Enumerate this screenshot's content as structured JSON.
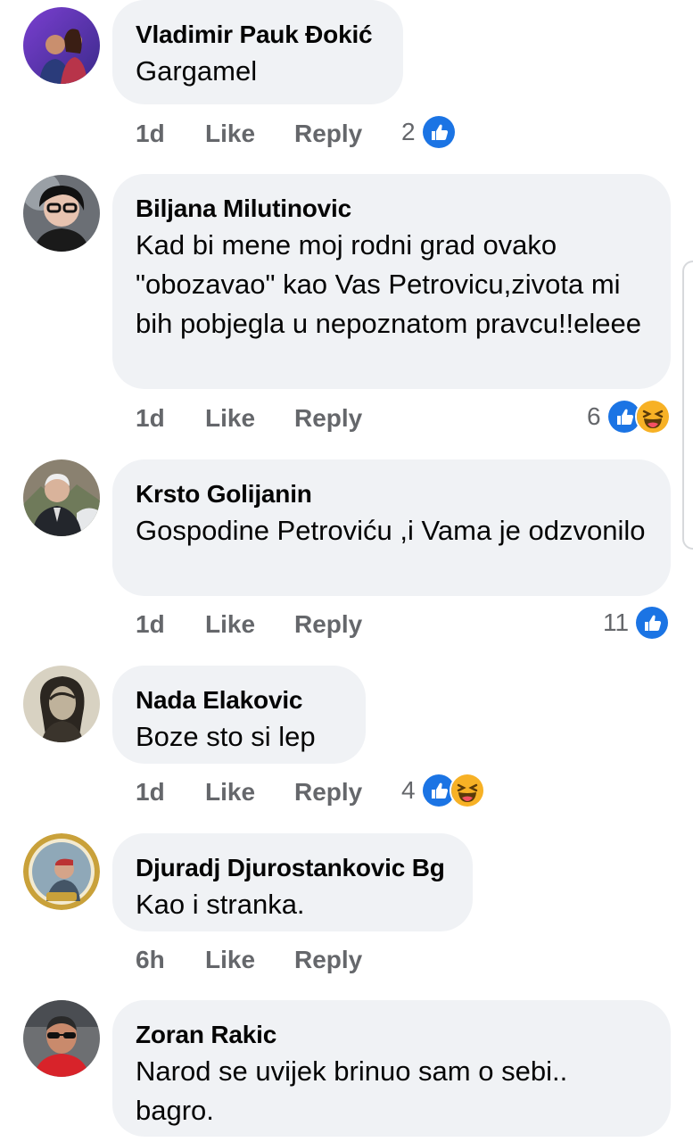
{
  "comments": [
    {
      "author": "Vladimir Pauk Đokić",
      "text": "Gargamel",
      "time": "1d",
      "like_label": "Like",
      "reply_label": "Reply",
      "reaction_count": "2",
      "reactions": [
        "like-icon"
      ]
    },
    {
      "author": "Biljana Milutinovic",
      "text": "Kad bi mene moj rodni grad ovako \"obozavao\" kao Vas Petrovicu,zivota mi bih pobjegla u nepoznatom pravcu!!eleee",
      "time": "1d",
      "like_label": "Like",
      "reply_label": "Reply",
      "reaction_count": "6",
      "reactions": [
        "like-icon",
        "haha-icon"
      ]
    },
    {
      "author": "Krsto Golijanin",
      "text": "Gospodine Petroviću ,i Vama je odzvonilo",
      "time": "1d",
      "like_label": "Like",
      "reply_label": "Reply",
      "reaction_count": "11",
      "reactions": [
        "like-icon"
      ]
    },
    {
      "author": "Nada Elakovic",
      "text": "Boze sto si lep",
      "time": "1d",
      "like_label": "Like",
      "reply_label": "Reply",
      "reaction_count": "4",
      "reactions": [
        "like-icon",
        "haha-icon"
      ]
    },
    {
      "author": "Djuradj Djurostankovic Bg",
      "text": "Kao i stranka.",
      "time": "6h",
      "like_label": "Like",
      "reply_label": "Reply",
      "reaction_count": "",
      "reactions": []
    },
    {
      "author": "Zoran Rakic",
      "text": "Narod se uvijek brinuo sam o sebi.. bagro.",
      "time": "",
      "like_label": "",
      "reply_label": "",
      "reaction_count": "",
      "reactions": []
    }
  ],
  "colors": {
    "bubble": "#f0f2f5",
    "like_blue": "#1b74e4",
    "haha_yellow": "#f7b125",
    "secondary_text": "#65676b"
  }
}
